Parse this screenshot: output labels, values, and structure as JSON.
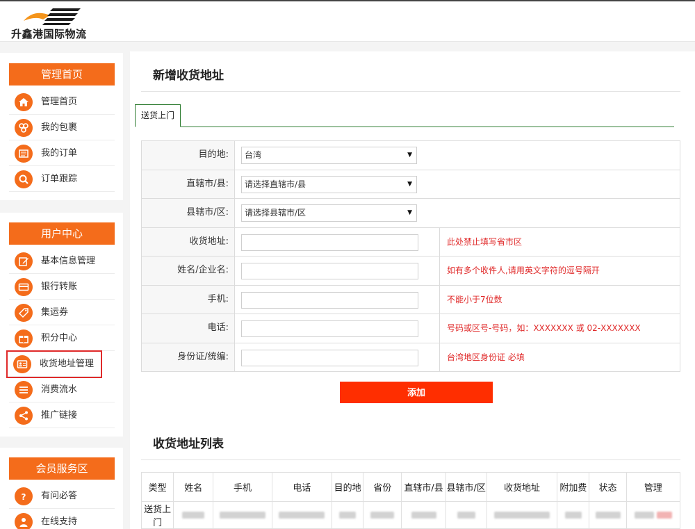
{
  "brand": {
    "name": "升鑫港国际物流",
    "accent": "#f46c1b"
  },
  "sidebar": {
    "panels": [
      {
        "title": "管理首页",
        "items": [
          {
            "label": "管理首页",
            "icon": "home-icon"
          },
          {
            "label": "我的包裹",
            "icon": "packages-icon"
          },
          {
            "label": "我的订单",
            "icon": "orders-icon"
          },
          {
            "label": "订单跟踪",
            "icon": "search-icon"
          }
        ]
      },
      {
        "title": "用户中心",
        "items": [
          {
            "label": "基本信息管理",
            "icon": "edit-icon"
          },
          {
            "label": "银行转账",
            "icon": "card-icon"
          },
          {
            "label": "集运券",
            "icon": "coupon-icon"
          },
          {
            "label": "积分中心",
            "icon": "gift-icon"
          },
          {
            "label": "收货地址管理",
            "icon": "address-card-icon",
            "active": true
          },
          {
            "label": "消费流水",
            "icon": "list-icon"
          },
          {
            "label": "推广链接",
            "icon": "share-icon"
          }
        ]
      },
      {
        "title": "会员服务区",
        "items": [
          {
            "label": "有问必答",
            "icon": "question-icon"
          },
          {
            "label": "在线支持",
            "icon": "user-icon"
          }
        ]
      }
    ]
  },
  "form": {
    "title": "新增收货地址",
    "tab": "送货上门",
    "rows": [
      {
        "label": "目的地:",
        "select": "台湾"
      },
      {
        "label": "直辖市/县:",
        "select": "请选择直辖市/县"
      },
      {
        "label": "县辖市/区:",
        "select": "请选择县辖市/区"
      },
      {
        "label": "收货地址:",
        "hint": "此处禁止填写省市区"
      },
      {
        "label": "姓名/企业名:",
        "hint": "如有多个收件人,请用英文字符的逗号隔开"
      },
      {
        "label": "手机:",
        "hint": "不能小于7位数"
      },
      {
        "label": "电话:",
        "hint": "号码或区号-号码，如：XXXXXXX 或 02-XXXXXXX"
      },
      {
        "label": "身份证/统编:",
        "hint": "台湾地区身份证 必填"
      }
    ],
    "submit": "添加"
  },
  "list": {
    "title": "收货地址列表",
    "columns": [
      "类型",
      "姓名",
      "手机",
      "电话",
      "目的地",
      "省份",
      "直辖市/县",
      "县辖市/区",
      "收货地址",
      "附加费",
      "状态",
      "管理"
    ],
    "rows": [
      {
        "type": "送货上门"
      }
    ]
  }
}
